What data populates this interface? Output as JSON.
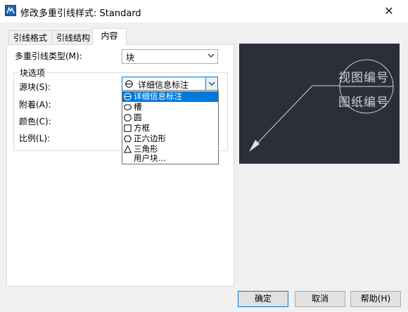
{
  "window": {
    "title": "修改多重引线样式: Standard",
    "close_glyph": "✕"
  },
  "tabs": [
    {
      "label": "引线格式"
    },
    {
      "label": "引线结构"
    },
    {
      "label": "内容"
    }
  ],
  "content": {
    "mleader_type_label": "多重引线类型(M):",
    "mleader_type_value": "块",
    "block_options_label": "块选项",
    "source_block_label": "源块(S):",
    "source_block_value": "详细信息标注",
    "attachment_label": "附着(A):",
    "color_label": "颜色(C):",
    "scale_label": "比例(L):"
  },
  "dropdown_options": [
    {
      "label": "详细信息标注",
      "icon": "circle-line-icon"
    },
    {
      "label": "槽",
      "icon": "slot-icon"
    },
    {
      "label": "圆",
      "icon": "circle-icon"
    },
    {
      "label": "方框",
      "icon": "box-icon"
    },
    {
      "label": "正六边形",
      "icon": "hexagon-icon"
    },
    {
      "label": "三角形",
      "icon": "triangle-icon"
    },
    {
      "label": "用户块...",
      "icon": ""
    }
  ],
  "preview": {
    "text_top": "视图编号",
    "text_bottom": "图纸编号"
  },
  "buttons": {
    "ok": "确定",
    "cancel": "取消",
    "help": "帮助(H)"
  },
  "colors": {
    "selection": "#0078d7",
    "preview_bg": "#2a2f3a"
  }
}
